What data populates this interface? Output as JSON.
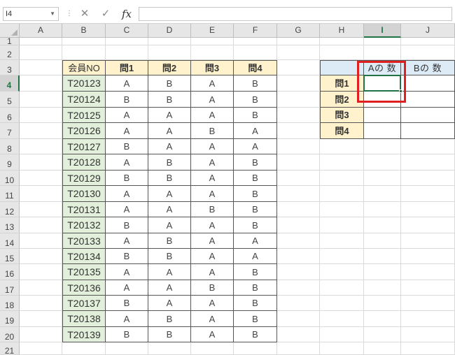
{
  "app": {
    "name_box": "I4",
    "fx_label": "fx",
    "formula_value": ""
  },
  "columns": [
    "A",
    "B",
    "C",
    "D",
    "E",
    "F",
    "G",
    "H",
    "I",
    "J"
  ],
  "active_col": "I",
  "rows": [
    "1",
    "2",
    "3",
    "4",
    "5",
    "6",
    "7",
    "8",
    "9",
    "10",
    "11",
    "12",
    "13",
    "14",
    "15",
    "16",
    "17",
    "18",
    "19",
    "20",
    "21"
  ],
  "active_row": "4",
  "left_table": {
    "headers": [
      "会員NO",
      "問1",
      "問2",
      "問3",
      "問4"
    ],
    "records": [
      {
        "id": "T20123",
        "answers": [
          "A",
          "B",
          "A",
          "B"
        ]
      },
      {
        "id": "T20124",
        "answers": [
          "B",
          "B",
          "A",
          "B"
        ]
      },
      {
        "id": "T20125",
        "answers": [
          "A",
          "A",
          "A",
          "B"
        ]
      },
      {
        "id": "T20126",
        "answers": [
          "A",
          "A",
          "B",
          "A"
        ]
      },
      {
        "id": "T20127",
        "answers": [
          "B",
          "A",
          "A",
          "A"
        ]
      },
      {
        "id": "T20128",
        "answers": [
          "A",
          "B",
          "A",
          "B"
        ]
      },
      {
        "id": "T20129",
        "answers": [
          "B",
          "B",
          "A",
          "B"
        ]
      },
      {
        "id": "T20130",
        "answers": [
          "A",
          "A",
          "A",
          "B"
        ]
      },
      {
        "id": "T20131",
        "answers": [
          "A",
          "A",
          "B",
          "B"
        ]
      },
      {
        "id": "T20132",
        "answers": [
          "B",
          "A",
          "A",
          "B"
        ]
      },
      {
        "id": "T20133",
        "answers": [
          "A",
          "B",
          "A",
          "A"
        ]
      },
      {
        "id": "T20134",
        "answers": [
          "B",
          "B",
          "A",
          "A"
        ]
      },
      {
        "id": "T20135",
        "answers": [
          "A",
          "A",
          "A",
          "B"
        ]
      },
      {
        "id": "T20136",
        "answers": [
          "A",
          "A",
          "B",
          "B"
        ]
      },
      {
        "id": "T20137",
        "answers": [
          "B",
          "A",
          "A",
          "B"
        ]
      },
      {
        "id": "T20138",
        "answers": [
          "A",
          "B",
          "A",
          "B"
        ]
      },
      {
        "id": "T20139",
        "answers": [
          "B",
          "B",
          "A",
          "B"
        ]
      }
    ]
  },
  "right_table": {
    "headers": [
      "",
      "Aの 数",
      "Bの 数"
    ],
    "rows": [
      "問1",
      "問2",
      "問3",
      "問4"
    ]
  },
  "colors": {
    "header_yellow": "#fff2cc",
    "id_green": "#e2efda",
    "header_blue": "#ddebf7",
    "highlight_red": "#e02020",
    "selection_green": "#217346"
  }
}
